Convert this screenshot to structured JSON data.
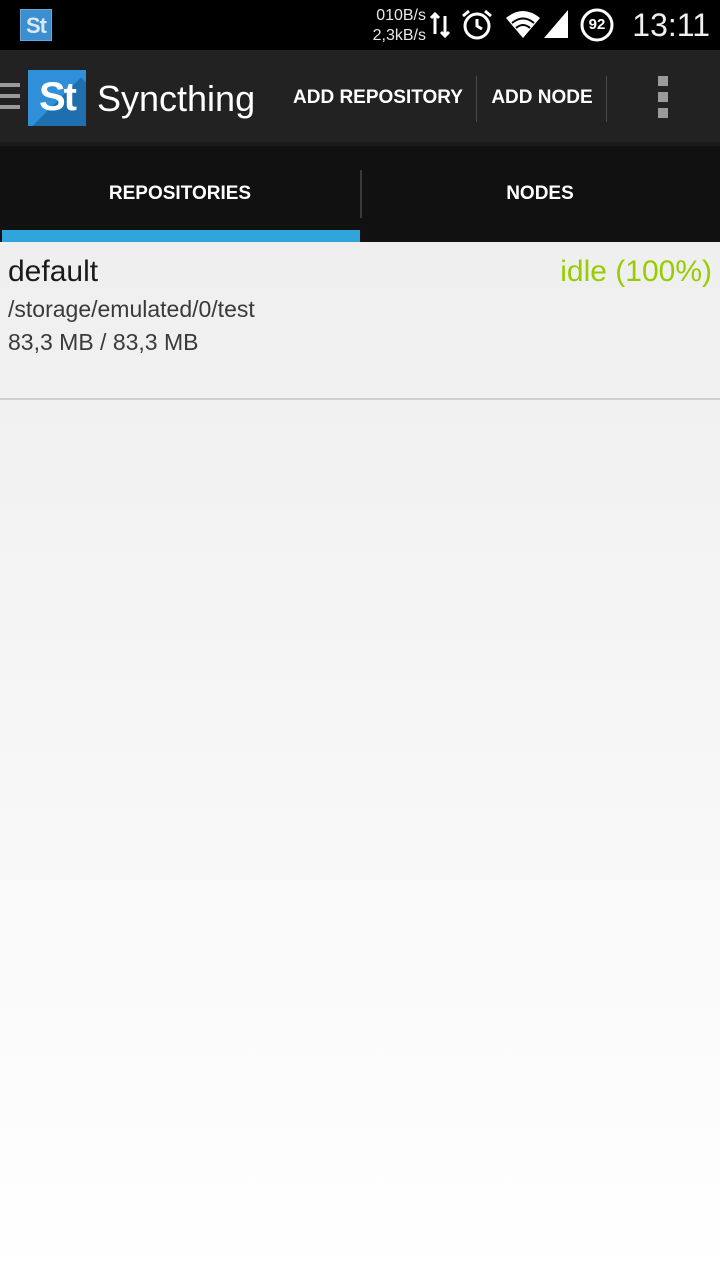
{
  "status_bar": {
    "app_icon_text": "St",
    "upload_speed": "010B/s",
    "download_speed": "2,3kB/s",
    "battery_level": "92",
    "time": "13:11",
    "icons": [
      "data-transfer-icon",
      "alarm-icon",
      "wifi-icon",
      "cell-signal-icon",
      "battery-icon"
    ]
  },
  "action_bar": {
    "logo_text": "St",
    "title": "Syncthing",
    "add_repository_label": "ADD REPOSITORY",
    "add_node_label": "ADD NODE",
    "icons": [
      "drawer-menu-icon",
      "overflow-menu-icon"
    ]
  },
  "tabs": [
    {
      "label": "REPOSITORIES",
      "selected": true
    },
    {
      "label": "NODES",
      "selected": false
    }
  ],
  "repositories": [
    {
      "name": "default",
      "status": "idle (100%)",
      "path": "/storage/emulated/0/test",
      "size": "83,3 MB / 83,3 MB"
    }
  ],
  "colors": {
    "accent": "#2fa5dc",
    "status_idle": "#99cc00",
    "action_bar": "#222222",
    "tab_bar": "#111111"
  }
}
